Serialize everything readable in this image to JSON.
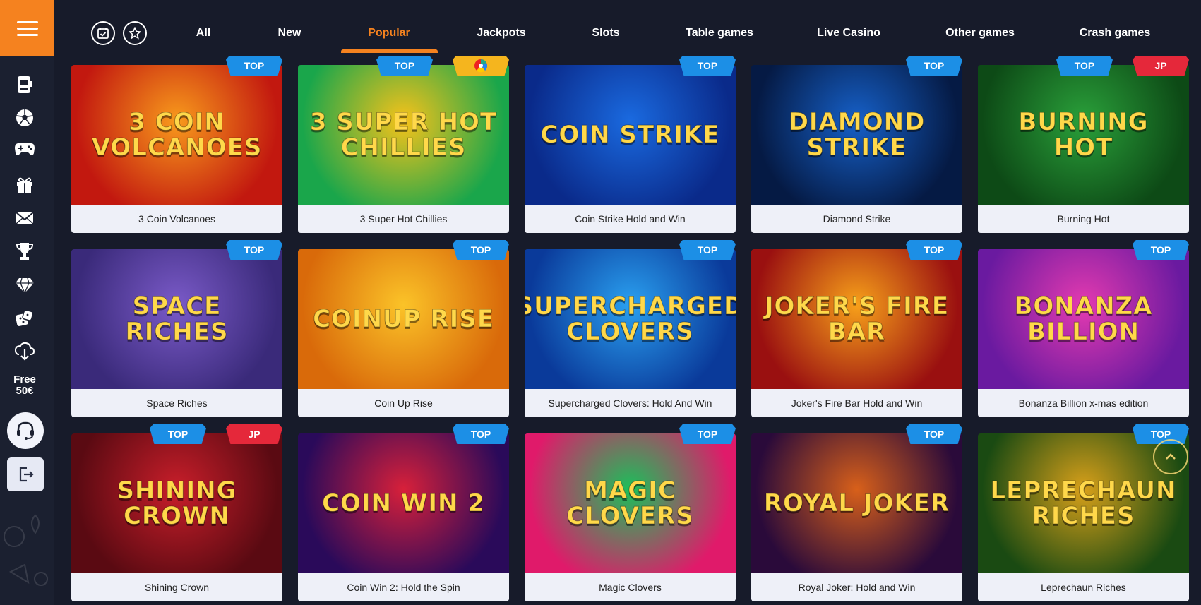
{
  "sidebar": {
    "menu_icon": "hamburger-icon",
    "icons": [
      "slot-machine-icon",
      "soccer-ball-icon",
      "gamepad-icon",
      "gift-icon",
      "envelope-icon",
      "trophy-icon",
      "diamond-icon",
      "dice-icon",
      "download-icon"
    ],
    "free_line1": "Free",
    "free_line2": "50€",
    "support_icon": "headset-icon",
    "logout_icon": "logout-icon"
  },
  "topnav": {
    "icons": [
      "calendar-check-icon",
      "star-icon"
    ],
    "tabs": [
      {
        "label": "All",
        "active": false
      },
      {
        "label": "New",
        "active": false
      },
      {
        "label": "Popular",
        "active": true
      },
      {
        "label": "Jackpots",
        "active": false
      },
      {
        "label": "Slots",
        "active": false
      },
      {
        "label": "Table games",
        "active": false
      },
      {
        "label": "Live Casino",
        "active": false
      },
      {
        "label": "Other games",
        "active": false
      },
      {
        "label": "Crash games",
        "active": false
      }
    ]
  },
  "games": [
    {
      "name": "3 Coin Volcanoes",
      "art": "3 COIN VOLCANOES",
      "badges": [
        "TOP"
      ],
      "colors": [
        "#c2180f",
        "#f89a1c"
      ]
    },
    {
      "name": "3 Super Hot Chillies",
      "art": "3 SUPER HOT CHILLIES",
      "badges": [
        "TOP",
        "WHEEL"
      ],
      "colors": [
        "#1aa64b",
        "#f7c21a"
      ]
    },
    {
      "name": "Coin Strike Hold and Win",
      "art": "COIN STRIKE",
      "badges": [
        "TOP"
      ],
      "colors": [
        "#0a2a8a",
        "#1a6ae0"
      ]
    },
    {
      "name": "Diamond Strike",
      "art": "DIAMOND STRIKE",
      "badges": [
        "TOP"
      ],
      "colors": [
        "#051a44",
        "#1660c8"
      ]
    },
    {
      "name": "Burning Hot",
      "art": "BURNING HOT",
      "badges": [
        "TOP",
        "JP"
      ],
      "colors": [
        "#0d4a16",
        "#2aa03a"
      ]
    },
    {
      "name": "Space Riches",
      "art": "SPACE RICHES",
      "badges": [
        "TOP"
      ],
      "colors": [
        "#3a2a7a",
        "#7a5ac8"
      ]
    },
    {
      "name": "Coin Up Rise",
      "art": "COINUP RISE",
      "badges": [
        "TOP"
      ],
      "colors": [
        "#d96a0a",
        "#fbc328"
      ]
    },
    {
      "name": "Supercharged Clovers: Hold And Win",
      "art": "SUPERCHARGED CLOVERS",
      "badges": [
        "TOP"
      ],
      "colors": [
        "#0a3a9a",
        "#2aa0f0"
      ]
    },
    {
      "name": "Joker's Fire Bar Hold and Win",
      "art": "JOKER'S FIRE BAR",
      "badges": [
        "TOP"
      ],
      "colors": [
        "#9a1010",
        "#f7a01a"
      ]
    },
    {
      "name": "Bonanza Billion x-mas edition",
      "art": "BONANZA BILLION",
      "badges": [
        "TOP"
      ],
      "colors": [
        "#6a1aa0",
        "#e43ab0"
      ]
    },
    {
      "name": "Shining Crown",
      "art": "SHINING CROWN",
      "badges": [
        "TOP",
        "JP"
      ],
      "colors": [
        "#5a0a12",
        "#c81e2a"
      ]
    },
    {
      "name": "Coin Win 2: Hold the Spin",
      "art": "COIN WIN 2",
      "badges": [
        "TOP"
      ],
      "colors": [
        "#2a0a5a",
        "#d8203a"
      ]
    },
    {
      "name": "Magic Clovers",
      "art": "MAGIC CLOVERS",
      "badges": [
        "TOP"
      ],
      "colors": [
        "#e01a6a",
        "#1ac05a"
      ]
    },
    {
      "name": "Royal Joker: Hold and Win",
      "art": "ROYAL JOKER",
      "badges": [
        "TOP"
      ],
      "colors": [
        "#2a0a3a",
        "#d8601a"
      ]
    },
    {
      "name": "Leprechaun Riches",
      "art": "LEPRECHAUN RICHES",
      "badges": [
        "TOP"
      ],
      "colors": [
        "#1a4a12",
        "#d8a01a"
      ]
    }
  ],
  "scroll_icon": "chevron-up-icon"
}
